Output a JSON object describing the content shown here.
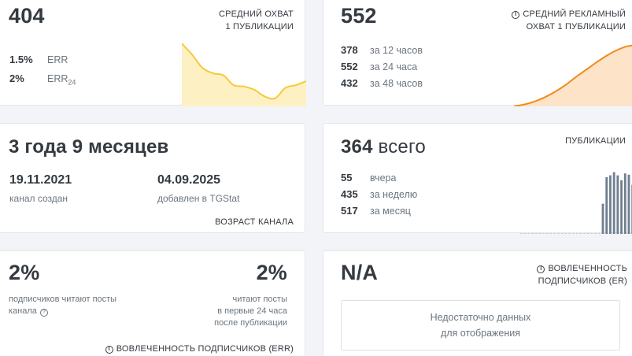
{
  "reach": {
    "value": "404",
    "caption_line1": "СРЕДНИЙ ОХВАТ",
    "caption_line2": "1 ПУБЛИКАЦИИ",
    "err": {
      "value": "1.5%",
      "label": "ERR"
    },
    "err24": {
      "value": "2%",
      "label": "ERR",
      "sub": "24"
    },
    "spark": [
      0.95,
      0.78,
      0.58,
      0.5,
      0.47,
      0.32,
      0.3,
      0.25,
      0.15,
      0.12,
      0.28,
      0.32,
      0.38
    ]
  },
  "ad_reach": {
    "value": "552",
    "caption_line1": "СРЕДНИЙ РЕКЛАМНЫЙ",
    "caption_line2": "ОХВАТ 1 ПУБЛИКАЦИИ",
    "rows": [
      {
        "value": "378",
        "label": "за 12 часов"
      },
      {
        "value": "552",
        "label": "за 24 часа"
      },
      {
        "value": "432",
        "label": "за 48 часов"
      }
    ],
    "curve": [
      0.0,
      0.03,
      0.08,
      0.15,
      0.24,
      0.35,
      0.48,
      0.6,
      0.72,
      0.83,
      0.92,
      0.98,
      1.0
    ]
  },
  "age": {
    "value": "3 года 9 месяцев",
    "created_date": "19.11.2021",
    "created_label": "канал создан",
    "added_date": "04.09.2025",
    "added_label": "добавлен в TGStat",
    "caption": "ВОЗРАСТ КАНАЛА"
  },
  "posts": {
    "value": "364",
    "value_suffix": "всего",
    "caption": "ПУБЛИКАЦИИ",
    "rows": [
      {
        "value": "55",
        "label": "вчера"
      },
      {
        "value": "435",
        "label": "за неделю"
      },
      {
        "value": "517",
        "label": "за месяц"
      }
    ],
    "bars": [
      0,
      0,
      0,
      0,
      0,
      0,
      0,
      0,
      0,
      0,
      0,
      0,
      0,
      0,
      0,
      0,
      0,
      0,
      0,
      0,
      0,
      0,
      0.48,
      0.9,
      0.93,
      0.98,
      0.93,
      0.85,
      0.96,
      0.94,
      0.78
    ]
  },
  "err_card": {
    "value_left": "2%",
    "label_left_line1": "подписчиков читают посты",
    "label_left_line2": "канала",
    "value_right": "2%",
    "label_right_line1": "читают посты",
    "label_right_line2": "в первые 24 часа",
    "label_right_line3": "после публикации",
    "caption": "ВОВЛЕЧЕННОСТЬ ПОДПИСЧИКОВ (ERR)"
  },
  "engagement": {
    "value": "N/A",
    "caption_line1": "ВОВЛЕЧЕННОСТЬ",
    "caption_line2": "ПОДПИСЧИКОВ (ER)",
    "nodata_line1": "Недостаточно данных",
    "nodata_line2": "для отображения"
  },
  "colors": {
    "reach_line": "#f7c938",
    "reach_fill": "#fdf1c4",
    "ad_line": "#f08a1c",
    "ad_fill": "#fde3c8",
    "bars": "#6f7f91"
  }
}
